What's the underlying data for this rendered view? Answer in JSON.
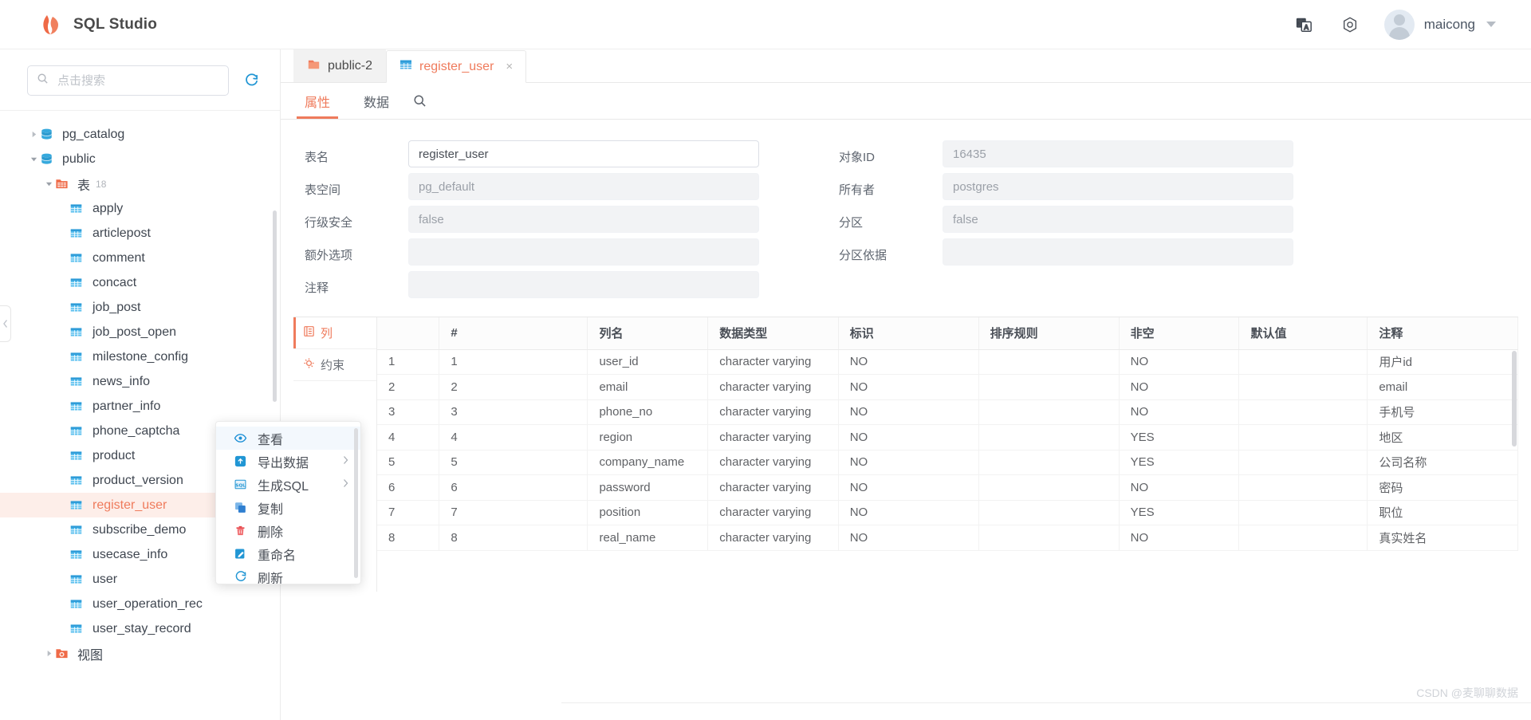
{
  "app": {
    "title": "SQL Studio",
    "logo_icon": "flame-logo-icon"
  },
  "topbar": {
    "translate_icon": "translate-icon",
    "theme_icon": "theme-circle-icon",
    "avatar_icon": "user-avatar",
    "username": "maicong",
    "dropdown_icon": "chevron-down-icon"
  },
  "sidebar": {
    "search": {
      "placeholder": "点击搜索",
      "value": "",
      "icon": "search-icon"
    },
    "refresh_icon": "refresh-icon",
    "collapse_icon": "chevron-left-icon",
    "tree": [
      {
        "label": "pg_catalog",
        "icon": "database-icon",
        "depth": 0,
        "arrow": "right",
        "selected": false
      },
      {
        "label": "public",
        "icon": "database-icon",
        "depth": 0,
        "arrow": "down",
        "selected": false
      },
      {
        "label": "表",
        "icon": "folder-table-icon",
        "depth": 1,
        "arrow": "down",
        "count": "18",
        "selected": false
      },
      {
        "label": "apply",
        "icon": "table-icon",
        "depth": 2,
        "arrow": "none",
        "selected": false
      },
      {
        "label": "articlepost",
        "icon": "table-icon",
        "depth": 2,
        "arrow": "none",
        "selected": false
      },
      {
        "label": "comment",
        "icon": "table-icon",
        "depth": 2,
        "arrow": "none",
        "selected": false
      },
      {
        "label": "concact",
        "icon": "table-icon",
        "depth": 2,
        "arrow": "none",
        "selected": false
      },
      {
        "label": "job_post",
        "icon": "table-icon",
        "depth": 2,
        "arrow": "none",
        "selected": false
      },
      {
        "label": "job_post_open",
        "icon": "table-icon",
        "depth": 2,
        "arrow": "none",
        "selected": false
      },
      {
        "label": "milestone_config",
        "icon": "table-icon",
        "depth": 2,
        "arrow": "none",
        "selected": false
      },
      {
        "label": "news_info",
        "icon": "table-icon",
        "depth": 2,
        "arrow": "none",
        "selected": false
      },
      {
        "label": "partner_info",
        "icon": "table-icon",
        "depth": 2,
        "arrow": "none",
        "selected": false
      },
      {
        "label": "phone_captcha",
        "icon": "table-icon",
        "depth": 2,
        "arrow": "none",
        "selected": false
      },
      {
        "label": "product",
        "icon": "table-icon",
        "depth": 2,
        "arrow": "none",
        "selected": false
      },
      {
        "label": "product_version",
        "icon": "table-icon",
        "depth": 2,
        "arrow": "none",
        "selected": false
      },
      {
        "label": "register_user",
        "icon": "table-icon",
        "depth": 2,
        "arrow": "none",
        "selected": true,
        "more": "···"
      },
      {
        "label": "subscribe_demo",
        "icon": "table-icon",
        "depth": 2,
        "arrow": "none",
        "selected": false
      },
      {
        "label": "usecase_info",
        "icon": "table-icon",
        "depth": 2,
        "arrow": "none",
        "selected": false
      },
      {
        "label": "user",
        "icon": "table-icon",
        "depth": 2,
        "arrow": "none",
        "selected": false
      },
      {
        "label": "user_operation_rec",
        "icon": "table-icon",
        "depth": 2,
        "arrow": "none",
        "selected": false
      },
      {
        "label": "user_stay_record",
        "icon": "table-icon",
        "depth": 2,
        "arrow": "none",
        "selected": false
      },
      {
        "label": "视图",
        "icon": "folder-view-icon",
        "depth": 1,
        "arrow": "right",
        "selected": false
      }
    ]
  },
  "context_menu": {
    "items": [
      {
        "label": "查看",
        "icon": "eye-icon",
        "submenu": false,
        "hovered": true
      },
      {
        "label": "导出数据",
        "icon": "export-icon",
        "submenu": true,
        "hovered": false
      },
      {
        "label": "生成SQL",
        "icon": "sql-icon",
        "submenu": true,
        "hovered": false
      },
      {
        "label": "复制",
        "icon": "copy-icon",
        "submenu": false,
        "hovered": false
      },
      {
        "label": "删除",
        "icon": "trash-icon",
        "submenu": false,
        "hovered": false
      },
      {
        "label": "重命名",
        "icon": "rename-icon",
        "submenu": false,
        "hovered": false
      },
      {
        "label": "刷新",
        "icon": "refresh-icon",
        "submenu": false,
        "hovered": false
      }
    ],
    "submenu_arrow": "chevron-right-icon"
  },
  "main": {
    "tabs": [
      {
        "label": "public-2",
        "icon": "schema-icon",
        "active": false,
        "closable": false
      },
      {
        "label": "register_user",
        "icon": "table-icon",
        "active": true,
        "closable": true,
        "close_label": "×"
      }
    ],
    "subtabs": [
      {
        "label": "属性",
        "active": true
      },
      {
        "label": "数据",
        "active": false
      }
    ],
    "search_icon": "search-icon",
    "form": {
      "left": [
        {
          "label": "表名",
          "value": "register_user",
          "readonly": false
        },
        {
          "label": "表空间",
          "value": "pg_default",
          "readonly": true
        },
        {
          "label": "行级安全",
          "value": "false",
          "readonly": true
        },
        {
          "label": "额外选项",
          "value": "",
          "readonly": true
        },
        {
          "label": "注释",
          "value": "",
          "readonly": true
        }
      ],
      "right": [
        {
          "label": "对象ID",
          "value": "16435",
          "readonly": true
        },
        {
          "label": "所有者",
          "value": "postgres",
          "readonly": true
        },
        {
          "label": "分区",
          "value": "false",
          "readonly": true
        },
        {
          "label": "分区依据",
          "value": "",
          "readonly": true
        }
      ]
    },
    "side_tabs": [
      {
        "label": "列",
        "icon": "list-icon",
        "active": true
      },
      {
        "label": "约束",
        "icon": "constraint-icon",
        "active": false
      }
    ],
    "table": {
      "headers": [
        "",
        "#",
        "列名",
        "数据类型",
        "标识",
        "排序规则",
        "非空",
        "默认值",
        "注释"
      ],
      "rows": [
        {
          "n": "1",
          "num": "1",
          "name": "user_id",
          "type": "character varying",
          "identity": "NO",
          "collation": "",
          "notnull": "NO",
          "default": "",
          "comment": "用户id"
        },
        {
          "n": "2",
          "num": "2",
          "name": "email",
          "type": "character varying",
          "identity": "NO",
          "collation": "",
          "notnull": "NO",
          "default": "",
          "comment": "email"
        },
        {
          "n": "3",
          "num": "3",
          "name": "phone_no",
          "type": "character varying",
          "identity": "NO",
          "collation": "",
          "notnull": "NO",
          "default": "",
          "comment": "手机号"
        },
        {
          "n": "4",
          "num": "4",
          "name": "region",
          "type": "character varying",
          "identity": "NO",
          "collation": "",
          "notnull": "YES",
          "default": "",
          "comment": "地区"
        },
        {
          "n": "5",
          "num": "5",
          "name": "company_name",
          "type": "character varying",
          "identity": "NO",
          "collation": "",
          "notnull": "YES",
          "default": "",
          "comment": "公司名称"
        },
        {
          "n": "6",
          "num": "6",
          "name": "password",
          "type": "character varying",
          "identity": "NO",
          "collation": "",
          "notnull": "NO",
          "default": "",
          "comment": "密码"
        },
        {
          "n": "7",
          "num": "7",
          "name": "position",
          "type": "character varying",
          "identity": "NO",
          "collation": "",
          "notnull": "YES",
          "default": "",
          "comment": "职位"
        },
        {
          "n": "8",
          "num": "8",
          "name": "real_name",
          "type": "character varying",
          "identity": "NO",
          "collation": "",
          "notnull": "NO",
          "default": "",
          "comment": "真实姓名"
        }
      ]
    }
  },
  "watermark": {
    "text": "CSDN @麦聊聊数据"
  },
  "colors": {
    "accent": "#ef7b5c",
    "link_blue": "#2196d4",
    "text": "#4a4f57"
  }
}
